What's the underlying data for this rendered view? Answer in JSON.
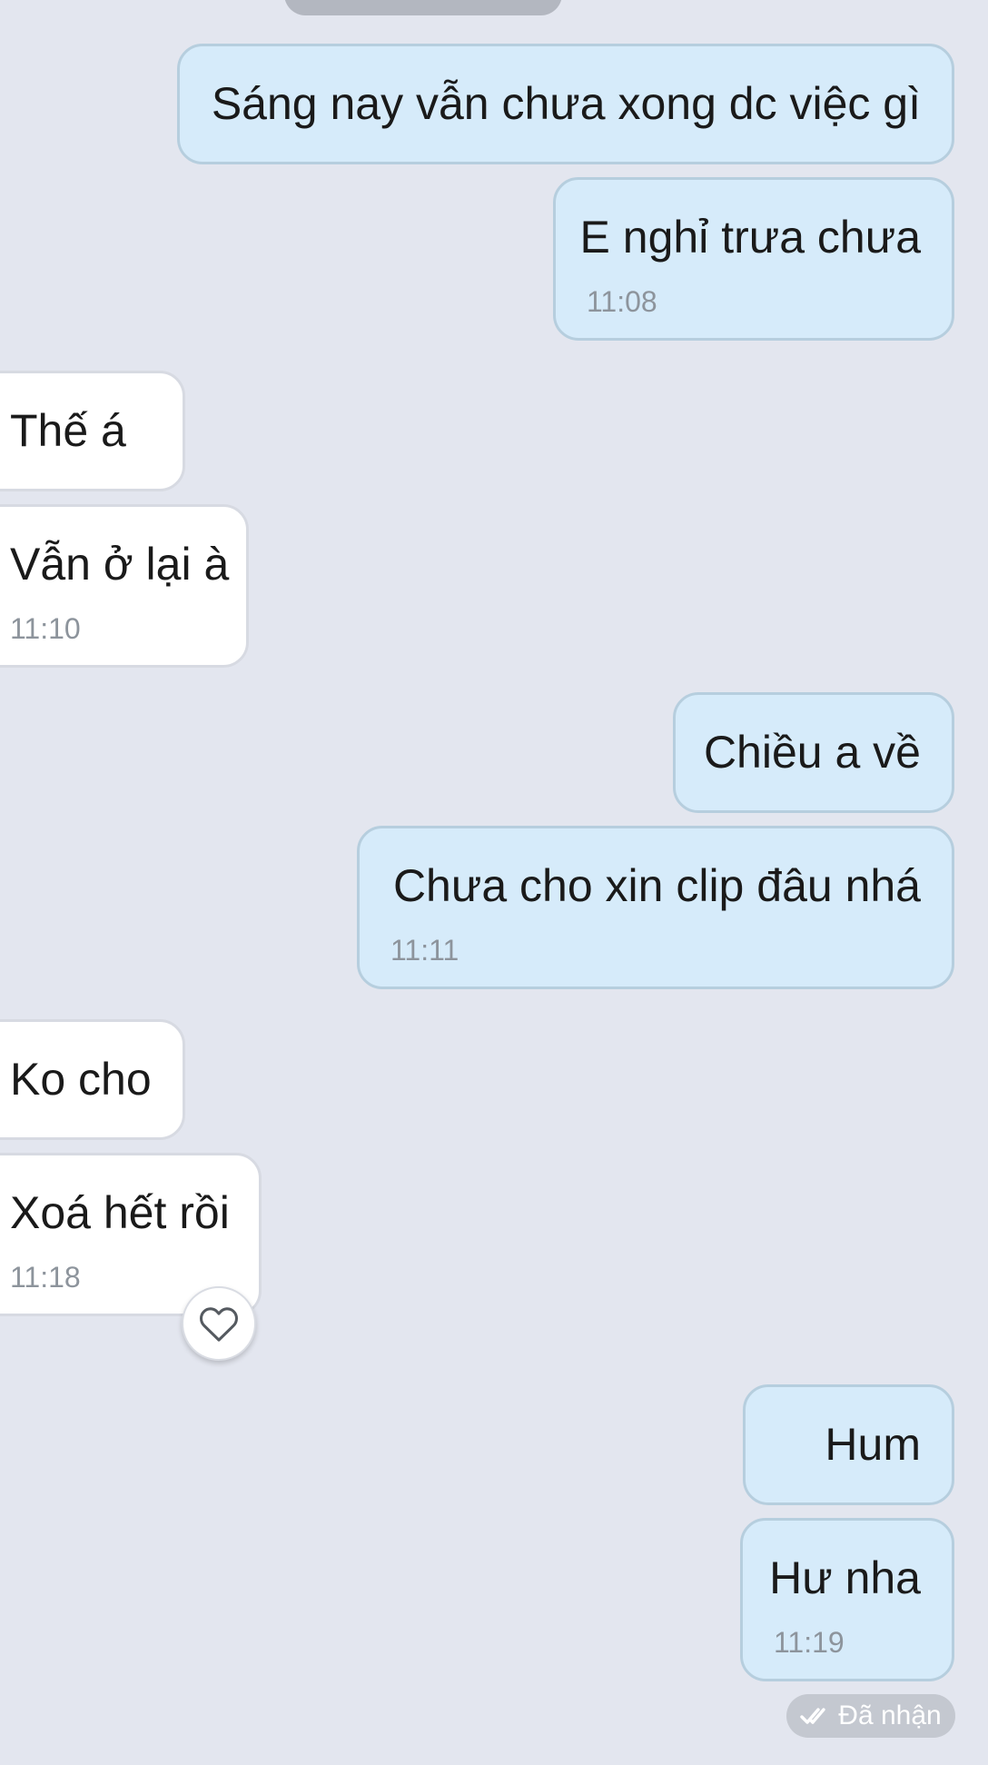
{
  "messages": [
    {
      "direction": "out",
      "text": "Sáng nay vẫn chưa xong dc việc gì"
    },
    {
      "direction": "out",
      "text": "E nghỉ trưa chưa",
      "time": "11:08"
    },
    {
      "direction": "in",
      "text": "Thế á"
    },
    {
      "direction": "in",
      "text": "Vẫn ở lại à",
      "time": "11:10"
    },
    {
      "direction": "out",
      "text": "Chiều a về"
    },
    {
      "direction": "out",
      "text": "Chưa cho xin clip đâu nhá",
      "time": "11:11"
    },
    {
      "direction": "in",
      "text": "Ko cho"
    },
    {
      "direction": "in",
      "text": "Xoá hết rồi",
      "time": "11:18"
    },
    {
      "direction": "out",
      "text": "Hum"
    },
    {
      "direction": "out",
      "text": "Hư nha",
      "time": "11:19"
    }
  ],
  "reaction": {
    "icon": "heart-outline-icon"
  },
  "status": {
    "icon": "double-check-icon",
    "label": "Đã nhận"
  },
  "colors": {
    "background": "#e3e6ef",
    "outgoing_bubble": "#d6ebfa",
    "incoming_bubble": "#ffffff",
    "time_text": "#8d949c",
    "status_pill": "#c4c8d0"
  }
}
